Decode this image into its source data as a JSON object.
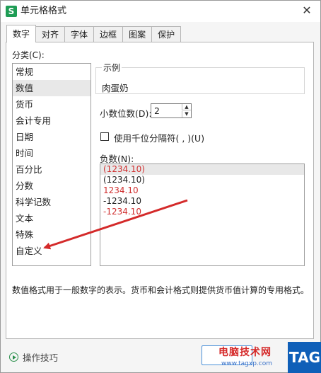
{
  "window": {
    "title": "单元格格式",
    "app_icon_letter": "S"
  },
  "tabs": [
    {
      "label": "数字",
      "active": true
    },
    {
      "label": "对齐",
      "active": false
    },
    {
      "label": "字体",
      "active": false
    },
    {
      "label": "边框",
      "active": false
    },
    {
      "label": "图案",
      "active": false
    },
    {
      "label": "保护",
      "active": false
    }
  ],
  "category": {
    "label": "分类(C):",
    "items": [
      "常规",
      "数值",
      "货币",
      "会计专用",
      "日期",
      "时间",
      "百分比",
      "分数",
      "科学记数",
      "文本",
      "特殊",
      "自定义"
    ],
    "selected_index": 1
  },
  "sample": {
    "title": "示例",
    "value": "肉蛋奶"
  },
  "decimal": {
    "label": "小数位数(D):",
    "value": "2"
  },
  "separator": {
    "label": "使用千位分隔符( , )(U)",
    "checked": false
  },
  "negative": {
    "label": "负数(N):",
    "items": [
      {
        "text": "(1234.10)",
        "color": "#d03030"
      },
      {
        "text": "(1234.10)",
        "color": "#222222"
      },
      {
        "text": "1234.10",
        "color": "#d03030"
      },
      {
        "text": "-1234.10",
        "color": "#222222"
      },
      {
        "text": "-1234.10",
        "color": "#d03030"
      }
    ],
    "selected_index": 0
  },
  "description": "数值格式用于一般数字的表示。货币和会计格式则提供货币值计算的专用格式。",
  "footer": {
    "tips_label": "操作技巧"
  },
  "watermark": {
    "site": "电脑技术网",
    "url": "www.tagxp.com",
    "logo": "TAG"
  },
  "colors": {
    "accent": "#4a90d9",
    "arrow": "#d42a2a",
    "app_icon": "#1f9d55",
    "tag_logo": "#0f5fb8"
  }
}
